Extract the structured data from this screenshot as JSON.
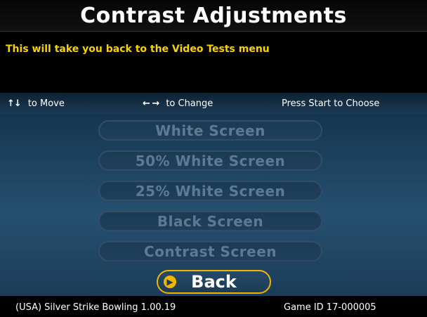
{
  "title": "Contrast Adjustments",
  "message": "This will take you back to the Video Tests menu",
  "instructions": {
    "move_arrows": "↑↓",
    "move_label": "to Move",
    "change_arrows": "← →",
    "change_label": "to Change",
    "choose_label": "Press Start to Choose"
  },
  "menu": {
    "items": [
      {
        "label": "White Screen"
      },
      {
        "label": "50% White Screen"
      },
      {
        "label": "25% White Screen"
      },
      {
        "label": "Black Screen"
      },
      {
        "label": "Contrast Screen"
      }
    ],
    "selected": {
      "label": "Back",
      "icon": "chevron-right-icon"
    }
  },
  "footer": {
    "game_info": "(USA) Silver Strike Bowling 1.00.19",
    "game_id": "Game ID 17-000005"
  },
  "colors": {
    "message": "#f5d400",
    "highlight": "#f2b600",
    "menu_background": "#1c3c57",
    "disabled_text": "#5e7a93"
  }
}
